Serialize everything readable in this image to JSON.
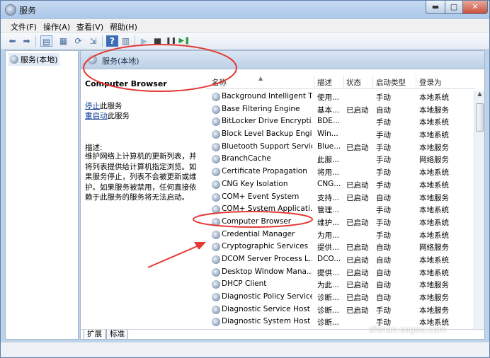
{
  "window": {
    "title": "服务",
    "min_glyph": "▬",
    "max_glyph": "▢",
    "close_glyph": "✕"
  },
  "menu": [
    "文件(F)",
    "操作(A)",
    "查看(V)",
    "帮助(H)"
  ],
  "toolbar_glyphs": {
    "back": "⬅",
    "forward": "➡",
    "up": "▤",
    "props": "▦",
    "refresh": "⟳",
    "export": "⇲",
    "help": "?",
    "view": "▥",
    "play": "▶",
    "stop": "■",
    "pause": "❚❚",
    "restart": "▶❚"
  },
  "tree": {
    "root_label": "服务(本地)"
  },
  "right_header": {
    "title": "服务(本地)"
  },
  "description_pane": {
    "service_name": "Computer Browser",
    "stop_link": "停止",
    "stop_suffix": "此服务",
    "restart_link": "重启动",
    "restart_suffix": "此服务",
    "desc_label": "描述:",
    "desc_text": "维护网络上计算机的更新列表，并将列表提供给计算机指定浏览。如果服务停止，列表不会被更新或维护。如果服务被禁用，任何直接依赖于此服务的服务将无法启动。"
  },
  "columns": {
    "name": "名称",
    "desc": "描述",
    "status": "状态",
    "start": "启动类型",
    "logon": "登录为"
  },
  "services": [
    {
      "name": "Background Intelligent T...",
      "desc": "使用...",
      "status": "",
      "start": "手动",
      "logon": "本地系统"
    },
    {
      "name": "Base Filtering Engine",
      "desc": "基本...",
      "status": "已启动",
      "start": "自动",
      "logon": "本地服务"
    },
    {
      "name": "BitLocker Drive Encrypti...",
      "desc": "BDE...",
      "status": "",
      "start": "手动",
      "logon": "本地系统"
    },
    {
      "name": "Block Level Backup Engi...",
      "desc": "Win...",
      "status": "",
      "start": "手动",
      "logon": "本地系统"
    },
    {
      "name": "Bluetooth Support Service",
      "desc": "Blue...",
      "status": "已启动",
      "start": "手动",
      "logon": "本地服务"
    },
    {
      "name": "BranchCache",
      "desc": "此服...",
      "status": "",
      "start": "手动",
      "logon": "网络服务"
    },
    {
      "name": "Certificate Propagation",
      "desc": "将用...",
      "status": "",
      "start": "手动",
      "logon": "本地系统"
    },
    {
      "name": "CNG Key Isolation",
      "desc": "CNG...",
      "status": "已启动",
      "start": "手动",
      "logon": "本地系统"
    },
    {
      "name": "COM+ Event System",
      "desc": "支持...",
      "status": "已启动",
      "start": "自动",
      "logon": "本地服务"
    },
    {
      "name": "COM+ System Applicati...",
      "desc": "管理...",
      "status": "",
      "start": "手动",
      "logon": "本地系统"
    },
    {
      "name": "Computer Browser",
      "desc": "维护...",
      "status": "已启动",
      "start": "手动",
      "logon": "本地系统"
    },
    {
      "name": "Credential Manager",
      "desc": "为用...",
      "status": "",
      "start": "手动",
      "logon": "本地系统"
    },
    {
      "name": "Cryptographic Services",
      "desc": "提供...",
      "status": "已启动",
      "start": "自动",
      "logon": "网络服务"
    },
    {
      "name": "DCOM Server Process L...",
      "desc": "DCO...",
      "status": "已启动",
      "start": "自动",
      "logon": "本地系统"
    },
    {
      "name": "Desktop Window Mana...",
      "desc": "提供...",
      "status": "已启动",
      "start": "自动",
      "logon": "本地系统"
    },
    {
      "name": "DHCP Client",
      "desc": "为此...",
      "status": "已启动",
      "start": "自动",
      "logon": "本地服务"
    },
    {
      "name": "Diagnostic Policy Service",
      "desc": "诊断...",
      "status": "已启动",
      "start": "自动",
      "logon": "本地服务"
    },
    {
      "name": "Diagnostic Service Host",
      "desc": "诊断...",
      "status": "已启动",
      "start": "手动",
      "logon": "本地服务"
    },
    {
      "name": "Diagnostic System Host",
      "desc": "诊断...",
      "status": "",
      "start": "手动",
      "logon": "本地系统"
    }
  ],
  "tabs": [
    "扩展",
    "标准"
  ],
  "watermark": "zhinan.sogou.com",
  "colors": {
    "annotation": "#e53935",
    "link": "#0a3d91"
  }
}
